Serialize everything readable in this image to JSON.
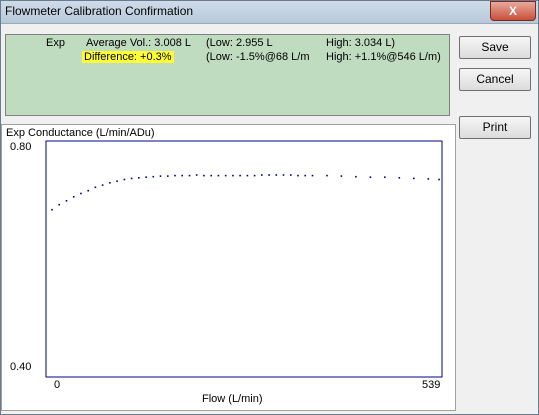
{
  "window": {
    "title": "Flowmeter Calibration Confirmation",
    "close_label": "X"
  },
  "info": {
    "row1": {
      "label": "Exp",
      "avg": "Average Vol.: 3.008 L",
      "low": "(Low: 2.955 L",
      "high": "High: 3.034 L)"
    },
    "row2": {
      "difference": "Difference: +0.3%",
      "low": "(Low: -1.5%@68 L/m",
      "high": "High: +1.1%@546 L/m)"
    },
    "background_color": "#c0dcc0",
    "highlight_color": "#ffff33"
  },
  "buttons": {
    "save": "Save",
    "cancel": "Cancel",
    "print": "Print"
  },
  "chart_data": {
    "type": "scatter",
    "title": "Exp  Conductance (L/min/ADu)",
    "xlabel": "Flow (L/min)",
    "ylabel": "",
    "xlim": [
      0,
      539
    ],
    "ylim": [
      0.4,
      0.8
    ],
    "x_ticks": [
      "0",
      "539"
    ],
    "y_ticks": [
      "0.80",
      "0.40"
    ],
    "grid": false,
    "point_color": "#00008b",
    "series": [
      {
        "x": [
          0,
          10,
          20,
          30,
          40,
          50,
          60,
          70,
          80,
          90,
          100,
          110,
          120,
          130,
          140,
          150,
          160,
          170,
          180,
          190,
          200,
          210,
          220,
          230,
          240,
          250,
          260,
          270,
          280,
          290,
          300,
          310,
          320,
          330,
          340,
          350,
          360,
          380,
          400,
          420,
          440,
          460,
          480,
          500,
          520,
          535
        ],
        "y": [
          0.688,
          0.697,
          0.704,
          0.711,
          0.717,
          0.722,
          0.728,
          0.732,
          0.736,
          0.739,
          0.742,
          0.744,
          0.745,
          0.746,
          0.747,
          0.748,
          0.748,
          0.749,
          0.749,
          0.749,
          0.75,
          0.749,
          0.749,
          0.749,
          0.749,
          0.749,
          0.749,
          0.749,
          0.749,
          0.75,
          0.75,
          0.75,
          0.75,
          0.75,
          0.749,
          0.749,
          0.749,
          0.749,
          0.748,
          0.747,
          0.746,
          0.746,
          0.745,
          0.744,
          0.743,
          0.742
        ]
      }
    ]
  }
}
